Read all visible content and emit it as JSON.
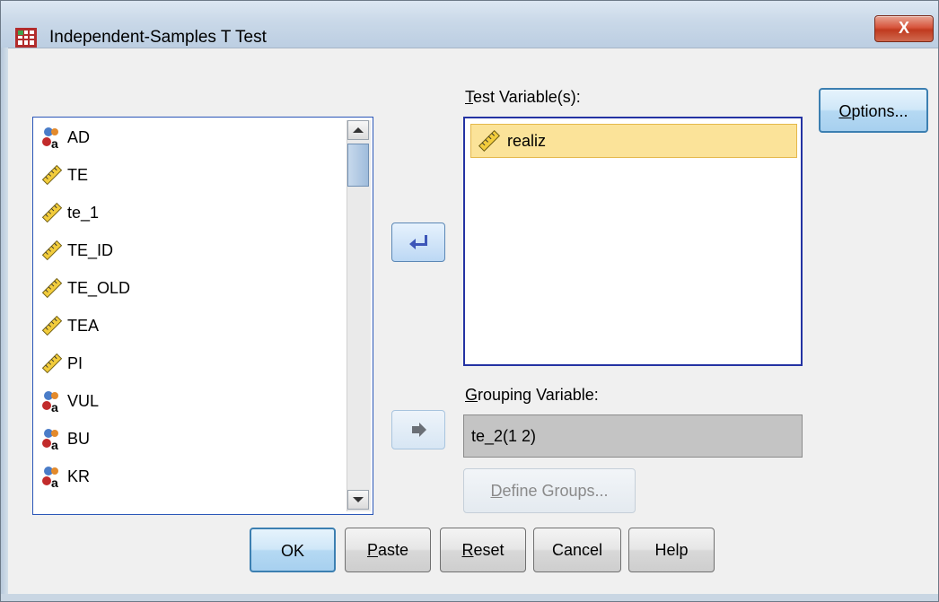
{
  "window": {
    "title": "Independent-Samples T Test",
    "close_label": "X"
  },
  "source_list": {
    "items": [
      {
        "label": "AD",
        "type": "nominal"
      },
      {
        "label": "TE",
        "type": "scale"
      },
      {
        "label": "te_1",
        "type": "scale"
      },
      {
        "label": "TE_ID",
        "type": "scale"
      },
      {
        "label": "TE_OLD",
        "type": "scale"
      },
      {
        "label": "TEA",
        "type": "scale"
      },
      {
        "label": "PI",
        "type": "scale"
      },
      {
        "label": "VUL",
        "type": "nominal"
      },
      {
        "label": "BU",
        "type": "nominal"
      },
      {
        "label": "KR",
        "type": "nominal"
      }
    ]
  },
  "test_variables": {
    "label": "Test Variable(s):",
    "items": [
      {
        "label": "realiz",
        "type": "scale"
      }
    ]
  },
  "grouping": {
    "label": "Grouping Variable:",
    "value": "te_2(1 2)",
    "define_groups_label": "Define Groups..."
  },
  "buttons": {
    "options": "Options...",
    "ok": "OK",
    "paste": "Paste",
    "reset": "Reset",
    "cancel": "Cancel",
    "help": "Help"
  },
  "colors": {
    "accent": "#2433a3",
    "selection": "#fbe399",
    "default_button": "#b5d9f3"
  }
}
